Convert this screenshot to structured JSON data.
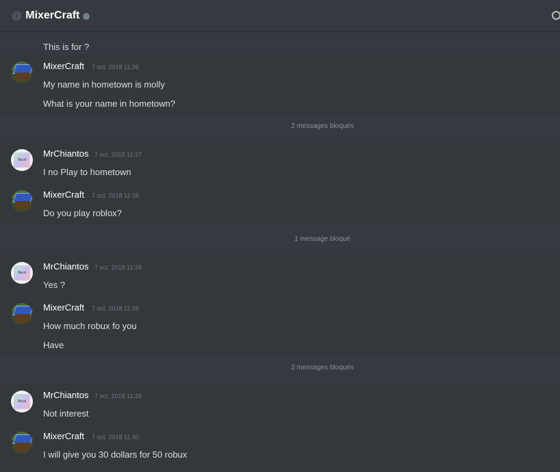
{
  "header": {
    "at_symbol": "@",
    "channel_name": "MixerCraft"
  },
  "messages": {
    "first_line": "This is for ?",
    "groups": [
      {
        "user": "MixerCraft",
        "timestamp": "7 oct. 2018 11:36",
        "lines": [
          "My name in hometown is molly",
          "What is your name in hometown?"
        ]
      },
      {
        "user": "MrChiantos",
        "timestamp": "7 oct. 2018 11:37",
        "lines": [
          "I no Play to hometown"
        ]
      },
      {
        "user": "MixerCraft",
        "timestamp": "7 oct. 2018 11:38",
        "lines": [
          "Do you play roblox?"
        ]
      },
      {
        "user": "MrChiantos",
        "timestamp": "7 oct. 2018 11:39",
        "lines": [
          "Yes ?"
        ]
      },
      {
        "user": "MixerCraft",
        "timestamp": "7 oct. 2018 11:39",
        "lines": [
          "How much robux fo you",
          "Have"
        ]
      },
      {
        "user": "MrChiantos",
        "timestamp": "7 oct. 2018 11:39",
        "lines": [
          "Not interest"
        ]
      },
      {
        "user": "MixerCraft",
        "timestamp": "7 oct. 2018 11:40",
        "lines": [
          "I will give you 30 dollars for 50 robux"
        ]
      }
    ],
    "blocked": [
      "2 messages bloqués",
      "1 message bloqué",
      "2 messages bloqués"
    ]
  },
  "colors": {
    "background": "#36393f",
    "username": "#ffffff",
    "text": "#dcddde",
    "timestamp": "#72767d",
    "status_offline": "#747f8d"
  }
}
